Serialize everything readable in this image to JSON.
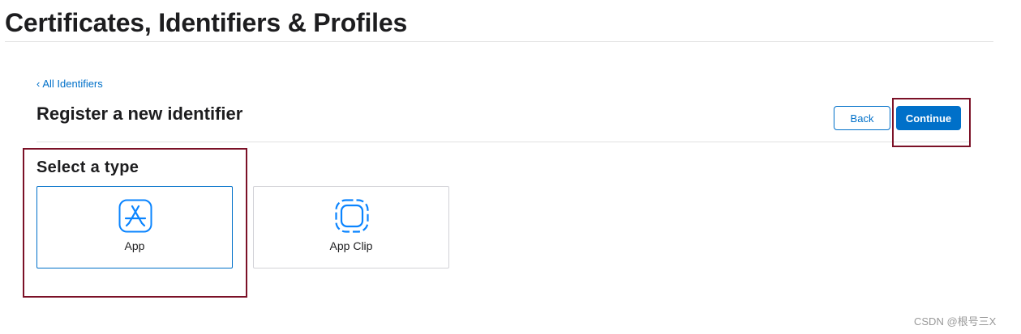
{
  "header": {
    "title": "Certificates, Identifiers & Profiles"
  },
  "nav": {
    "back_link": "All Identifiers"
  },
  "page": {
    "heading": "Register a new identifier"
  },
  "actions": {
    "back_label": "Back",
    "continue_label": "Continue"
  },
  "type_select": {
    "heading": "Select a type",
    "options": [
      {
        "label": "App",
        "icon": "app-store-icon",
        "selected": true
      },
      {
        "label": "App Clip",
        "icon": "app-clip-icon",
        "selected": false
      }
    ]
  },
  "watermark": {
    "text": "CSDN @根号三X"
  },
  "colors": {
    "accent": "#0070c9",
    "highlight_box": "#7b1127",
    "text": "#1d1d1f",
    "divider": "#e1e1e1"
  }
}
